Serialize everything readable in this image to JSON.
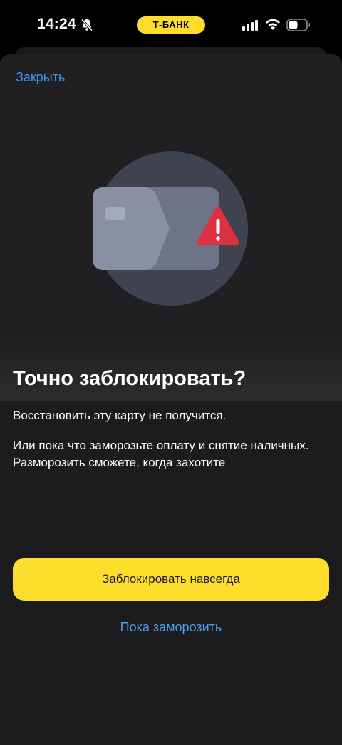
{
  "status_bar": {
    "time": "14:24",
    "bank_label": "Т-БАНК",
    "icons": [
      "bell-slash-icon",
      "signal-icon",
      "wifi-icon",
      "battery-icon"
    ]
  },
  "colors": {
    "accent_yellow": "#ffdd2d",
    "link_blue": "#3b94f0",
    "sheet_bg": "#1c1c1e",
    "warning_red": "#e0303a"
  },
  "sheet": {
    "close_label": "Закрыть",
    "illustration": "blocked-card-warning-icon"
  },
  "content": {
    "title": "Точно заблокировать?",
    "paragraph1": "Восстановить эту карту не получится.",
    "paragraph2": "Или пока что заморозьте оплату и снятие наличных. Разморозить сможете, когда захотите"
  },
  "actions": {
    "primary_label": "Заблокировать навсегда",
    "secondary_label": "Пока заморозить"
  }
}
